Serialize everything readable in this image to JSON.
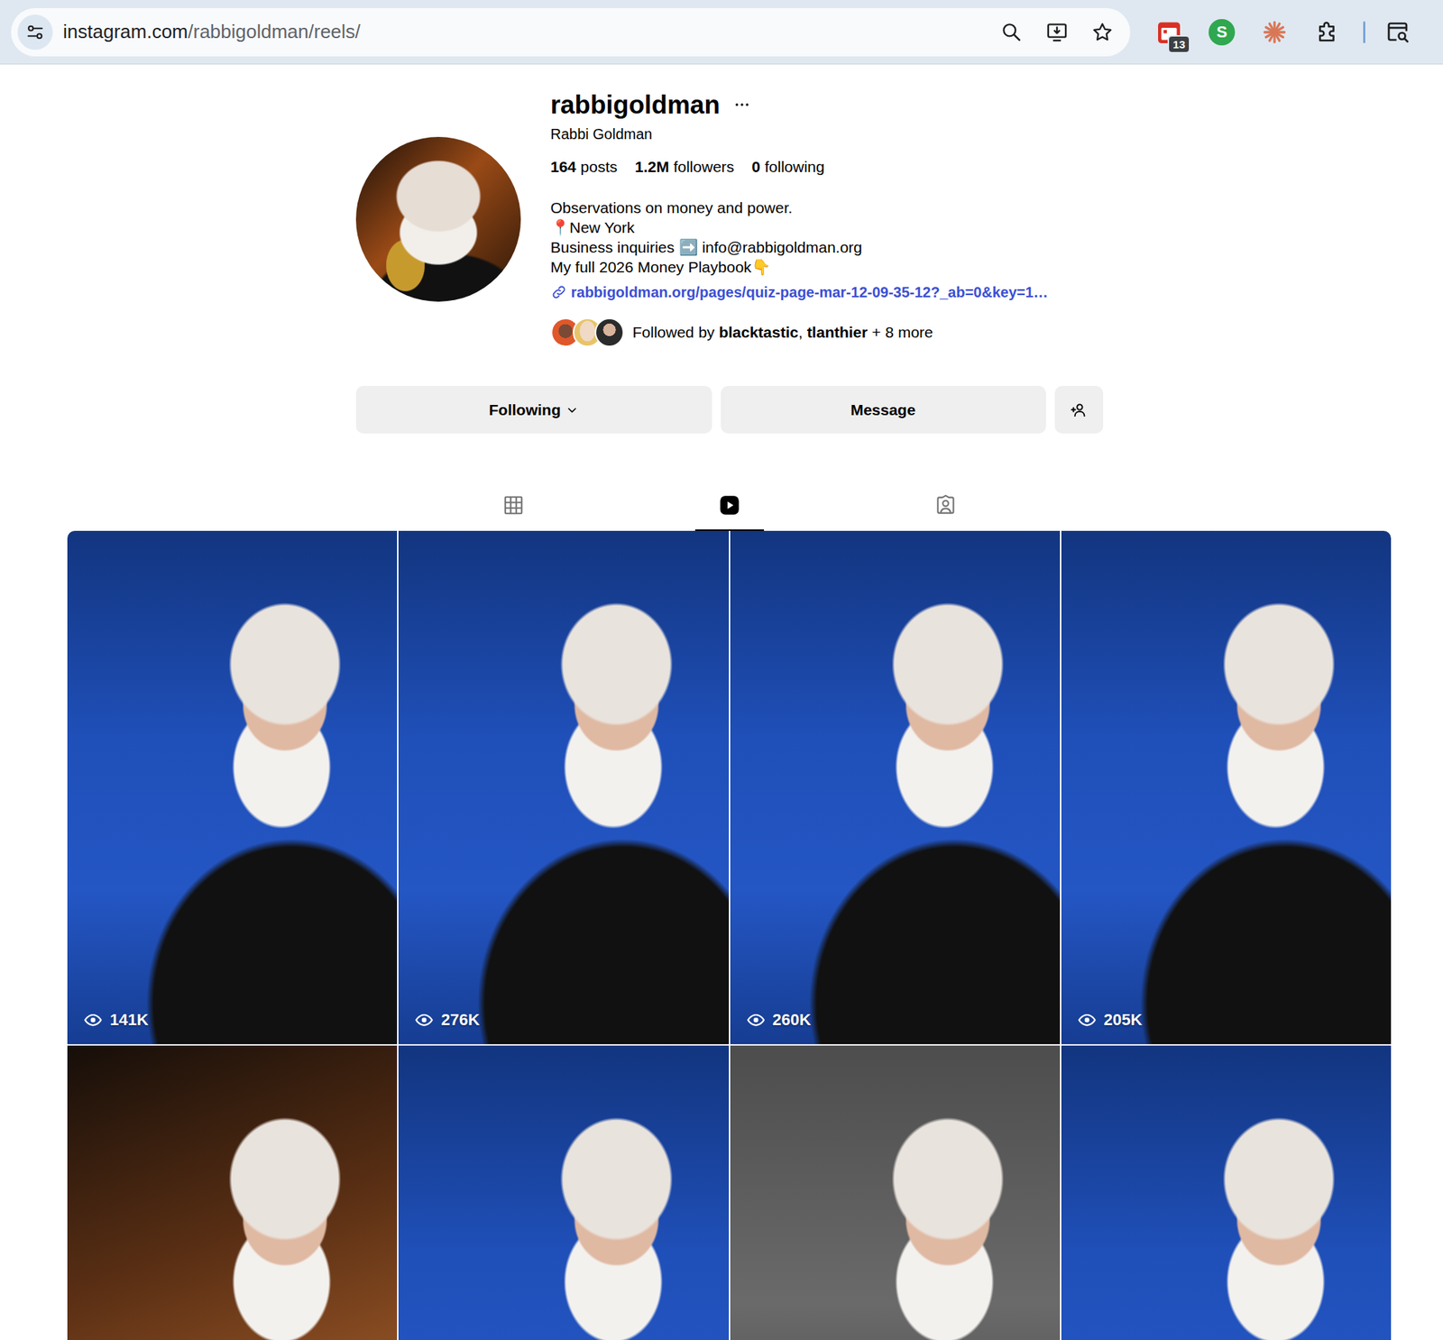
{
  "browser": {
    "address": {
      "host": "instagram.com",
      "path": "/rabbigoldman/reels/"
    },
    "extensions": [
      {
        "kind": "calendar",
        "badge": "13"
      },
      {
        "kind": "letter",
        "label": "S"
      },
      {
        "kind": "asterisk"
      },
      {
        "kind": "puzzle"
      }
    ]
  },
  "profile": {
    "username": "rabbigoldman",
    "full_name": "Rabbi Goldman",
    "stats": [
      {
        "value": "164",
        "label": "posts"
      },
      {
        "value": "1.2M",
        "label": "followers"
      },
      {
        "value": "0",
        "label": "following"
      }
    ],
    "bio": [
      "Observations on money and power.",
      "📍New York",
      "Business inquiries ➡️ info@rabbigoldman.org",
      "My full 2026 Money Playbook👇"
    ],
    "link": "rabbigoldman.org/pages/quiz-page-mar-12-09-35-12?_ab=0&key=1…",
    "followed_by": [
      {
        "text": "Followed by ",
        "bold": false
      },
      {
        "text": "blacktastic",
        "bold": true
      },
      {
        "text": ", ",
        "bold": false
      },
      {
        "text": "tlanthier",
        "bold": true
      },
      {
        "text": " + 8 more",
        "bold": false
      }
    ]
  },
  "actions": [
    {
      "kind": "dropdown",
      "label": "Following"
    },
    {
      "kind": "button",
      "label": "Message"
    },
    {
      "kind": "add-person"
    }
  ],
  "tabs": [
    {
      "kind": "grid",
      "selected": false
    },
    {
      "kind": "reels",
      "selected": true
    },
    {
      "kind": "tagged",
      "selected": false
    }
  ],
  "reels": [
    {
      "kind": "blue-car",
      "views": "141K"
    },
    {
      "kind": "blue-car",
      "views": "276K"
    },
    {
      "kind": "blue-car",
      "views": "260K"
    },
    {
      "kind": "blue-car",
      "views": "205K"
    },
    {
      "kind": "orange-car"
    },
    {
      "kind": "blue-car"
    },
    {
      "kind": "office"
    },
    {
      "kind": "blue-car"
    }
  ]
}
